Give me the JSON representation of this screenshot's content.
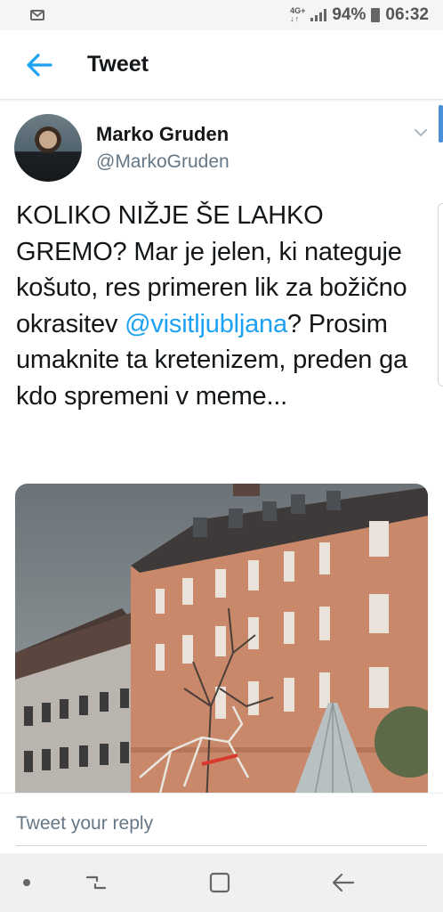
{
  "status_bar": {
    "network_top": "4G+",
    "battery": "94%",
    "time": "06:32",
    "icons": [
      "mail-icon",
      "signal-icon",
      "battery-icon"
    ]
  },
  "app_bar": {
    "title": "Tweet",
    "back_icon": "arrow-left-icon"
  },
  "tweet": {
    "author_name": "Marko Gruden",
    "author_handle": "@MarkoGruden",
    "text_before": "KOLIKO NIŽJE ŠE LAHKO GREMO? Mar je jelen, ki nateguje košuto, res primeren lik za božično okrasitev ",
    "mention": "@visitljubljana",
    "text_after": "? Prosim uma­knite ta kretenizem, preden ga kdo spremeni v meme...",
    "menu_icon": "chevron-down-icon"
  },
  "reply": {
    "placeholder": "Tweet your reply"
  },
  "nav_bar": {
    "icons": [
      "dot-icon",
      "recent-apps-icon",
      "home-icon",
      "back-icon"
    ]
  },
  "colors": {
    "accent": "#1da1f2",
    "text": "#14171a",
    "secondary": "#657786"
  }
}
